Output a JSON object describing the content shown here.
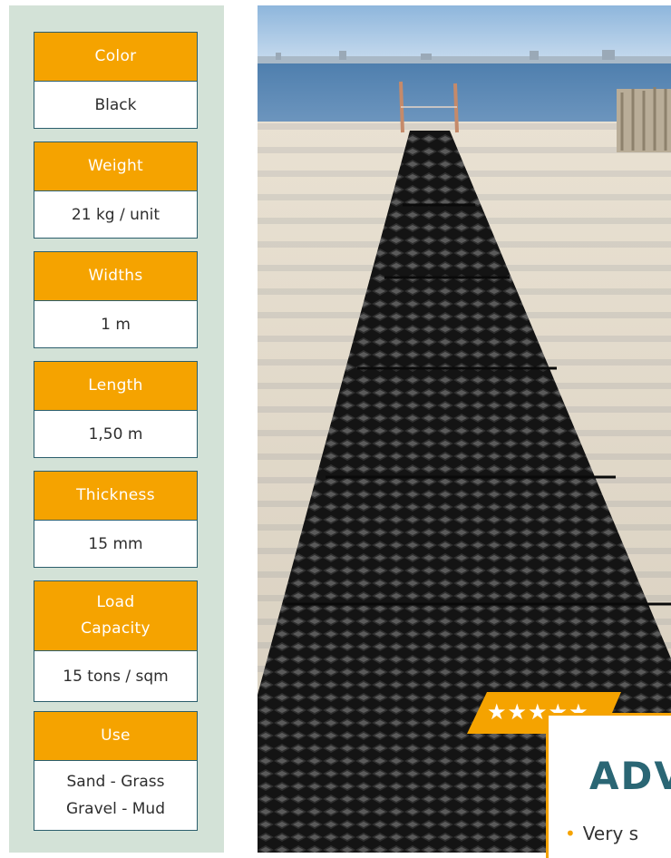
{
  "specs": [
    {
      "label": "Color",
      "value": "Black"
    },
    {
      "label": "Weight",
      "value": "21 kg / unit"
    },
    {
      "label": "Widths",
      "value": "1 m"
    },
    {
      "label": "Length",
      "value": "1,50 m"
    },
    {
      "label": "Thickness",
      "value": "15 mm"
    },
    {
      "label": "Load\nCapacity",
      "value": "15 tons / sqm"
    },
    {
      "label": "Use",
      "value": "Sand - Grass\nGravel - Mud"
    }
  ],
  "rating": {
    "stars": "★★★★★",
    "count": 5
  },
  "advantages": {
    "title": "ADV",
    "bullet": "Very s"
  },
  "colors": {
    "accent": "#f5a300",
    "teal": "#2b5e6c",
    "panel": "#d3e2d7"
  }
}
